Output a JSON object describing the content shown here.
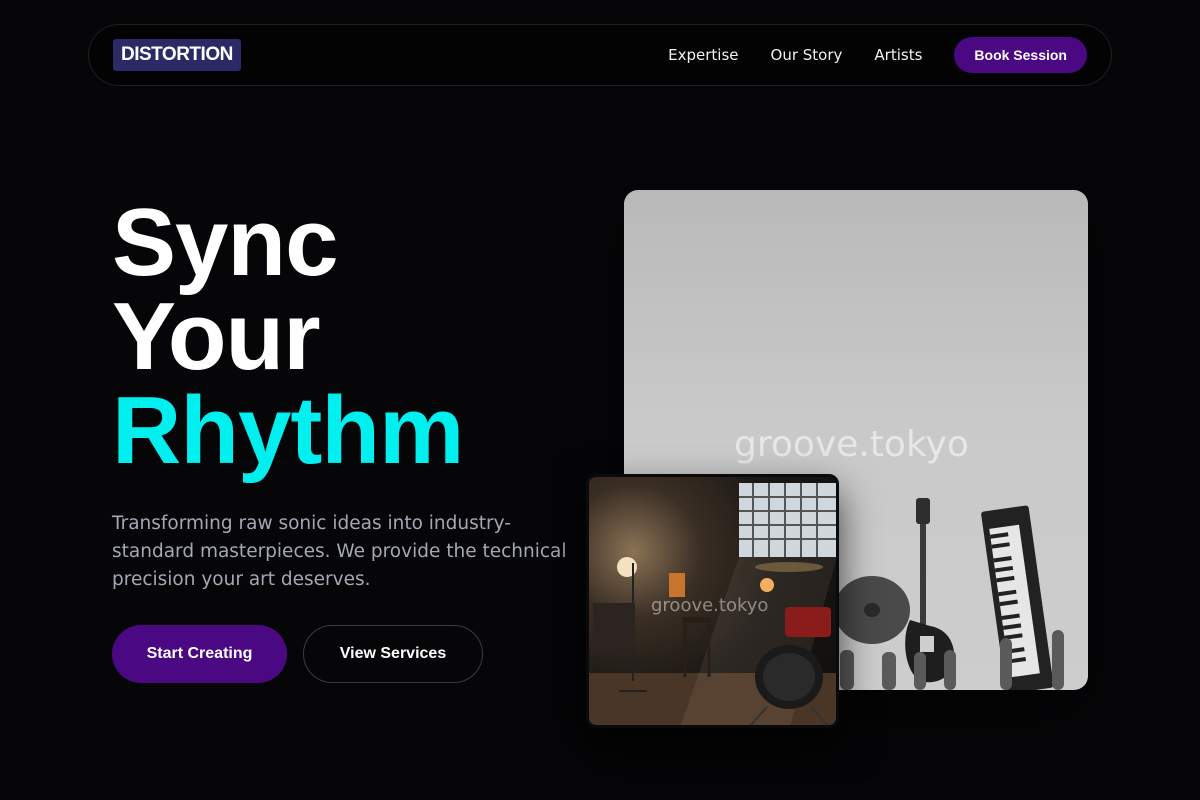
{
  "brand": {
    "logo": "DISTORTION"
  },
  "nav": {
    "links": [
      "Expertise",
      "Our Story",
      "Artists"
    ],
    "cta": "Book Session"
  },
  "hero": {
    "title_line1": "Sync",
    "title_line2": "Your",
    "title_line3": "Rhythm",
    "description": "Transforming raw sonic ideas into industry-standard masterpieces. We provide the technical precision your art deserves.",
    "primary_button": "Start Creating",
    "secondary_button": "View Services"
  },
  "images": {
    "main_watermark": "groove.tokyo",
    "inset_watermark": "groove.tokyo"
  },
  "colors": {
    "background": "#060608",
    "accent": "#00f0f0",
    "brand_purple": "#4b0883",
    "logo_bg": "#2b2a66"
  }
}
